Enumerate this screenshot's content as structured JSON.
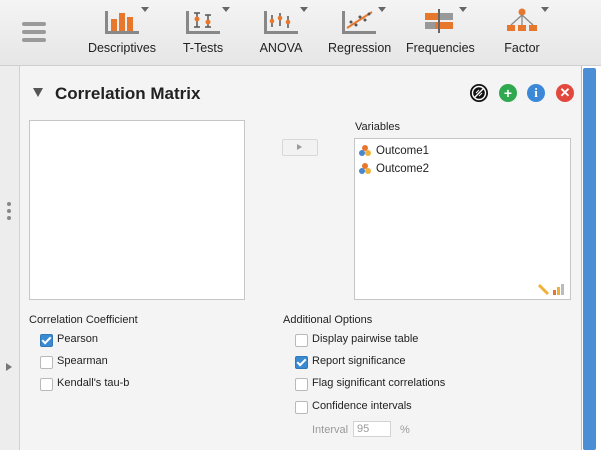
{
  "ribbon": {
    "menu_icon": "hamburger-menu-icon",
    "buttons": [
      {
        "label": "Descriptives",
        "icon": "bar-chart-icon",
        "has_dropdown": true
      },
      {
        "label": "T-Tests",
        "icon": "t-test-icon",
        "has_dropdown": true
      },
      {
        "label": "ANOVA",
        "icon": "anova-icon",
        "has_dropdown": true
      },
      {
        "label": "Regression",
        "icon": "scatter-regression-icon",
        "has_dropdown": true
      },
      {
        "label": "Frequencies",
        "icon": "frequencies-icon",
        "has_dropdown": true
      },
      {
        "label": "Factor",
        "icon": "factor-tree-icon",
        "has_dropdown": true
      }
    ]
  },
  "analysis": {
    "title": "Correlation Matrix",
    "header_icons": [
      "status-icon",
      "add-icon",
      "info-icon",
      "close-icon"
    ]
  },
  "variables": {
    "label": "Variables",
    "items": [
      "Outcome1",
      "Outcome2"
    ]
  },
  "correlation_coefficient": {
    "heading": "Correlation Coefficient",
    "options": [
      {
        "label": "Pearson",
        "checked": true
      },
      {
        "label": "Spearman",
        "checked": false
      },
      {
        "label": "Kendall's tau-b",
        "checked": false
      }
    ]
  },
  "additional_options": {
    "heading": "Additional Options",
    "options": [
      {
        "label": "Display pairwise table",
        "checked": false
      },
      {
        "label": "Report significance",
        "checked": true
      },
      {
        "label": "Flag significant correlations",
        "checked": false
      },
      {
        "label": "Confidence intervals",
        "checked": false
      }
    ],
    "interval_label": "Interval",
    "interval_value": "95",
    "interval_unit": "%"
  },
  "colors": {
    "accent": "#3a8ad2",
    "scrollbar": "#4a8fd6",
    "add_green": "#2fa84f",
    "info_blue": "#3b88d8",
    "close_red": "#e2483d",
    "ribbon_orange": "#e8772e"
  }
}
